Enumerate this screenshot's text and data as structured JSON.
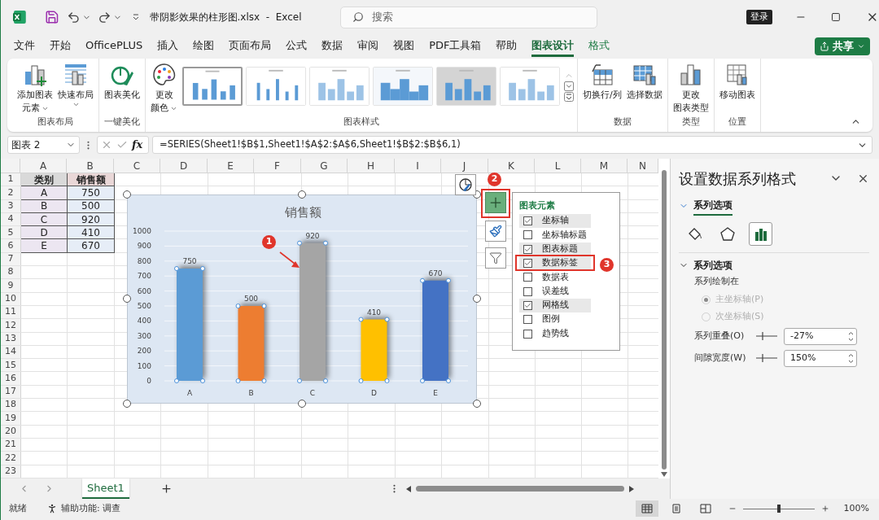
{
  "window": {
    "title": "带阴影效果的柱形图.xlsx  -  Excel"
  },
  "search": {
    "placeholder": "搜索"
  },
  "sign_in": "登录",
  "menu_tabs": [
    {
      "label": "文件",
      "selected": false,
      "kind": "normal"
    },
    {
      "label": "开始",
      "selected": false,
      "kind": "normal"
    },
    {
      "label": "OfficePLUS",
      "selected": false,
      "kind": "normal"
    },
    {
      "label": "插入",
      "selected": false,
      "kind": "normal"
    },
    {
      "label": "绘图",
      "selected": false,
      "kind": "normal"
    },
    {
      "label": "页面布局",
      "selected": false,
      "kind": "normal"
    },
    {
      "label": "公式",
      "selected": false,
      "kind": "normal"
    },
    {
      "label": "数据",
      "selected": false,
      "kind": "normal"
    },
    {
      "label": "审阅",
      "selected": false,
      "kind": "normal"
    },
    {
      "label": "视图",
      "selected": false,
      "kind": "normal"
    },
    {
      "label": "PDF工具箱",
      "selected": false,
      "kind": "normal"
    },
    {
      "label": "帮助",
      "selected": false,
      "kind": "normal"
    },
    {
      "label": "图表设计",
      "selected": true,
      "kind": "context"
    },
    {
      "label": "格式",
      "selected": false,
      "kind": "context"
    }
  ],
  "share": "共享",
  "ribbon": {
    "groups": [
      {
        "label": "图表布局",
        "buttons": [
          {
            "lines": [
              "添加图表",
              "元素"
            ],
            "dropdown": true
          },
          {
            "lines": [
              "快速布局"
            ],
            "dropdown": true
          }
        ]
      },
      {
        "label": "一键美化",
        "buttons": [
          {
            "lines": [
              "图表美化"
            ],
            "dropdown": false
          }
        ]
      },
      {
        "label": "图表样式",
        "buttons": [
          {
            "lines": [
              "更改",
              "颜色"
            ],
            "dropdown": true
          }
        ],
        "gallery": [
          {
            "kind": "plain",
            "selected": true
          },
          {
            "kind": "thin",
            "selected": false
          },
          {
            "kind": "striped",
            "selected": false
          },
          {
            "kind": "bold",
            "selected": false
          },
          {
            "kind": "shaded",
            "selected": false
          },
          {
            "kind": "light",
            "selected": false
          }
        ]
      },
      {
        "label": "数据",
        "buttons": [
          {
            "lines": [
              "切换行/列"
            ],
            "dropdown": false
          },
          {
            "lines": [
              "选择数据"
            ],
            "dropdown": false
          }
        ]
      },
      {
        "label": "类型",
        "buttons": [
          {
            "lines": [
              "更改",
              "图表类型"
            ],
            "dropdown": false
          }
        ]
      },
      {
        "label": "位置",
        "buttons": [
          {
            "lines": [
              "移动图表"
            ],
            "dropdown": false
          }
        ]
      }
    ]
  },
  "formula_bar": {
    "name_box": "图表 2",
    "function_label": "fx",
    "formula": "=SERIES(Sheet1!$B$1,Sheet1!$A$2:$A$6,Sheet1!$B$2:$B$6,1)"
  },
  "grid": {
    "columns": [
      "A",
      "B",
      "C",
      "D",
      "E",
      "F",
      "G",
      "H",
      "I",
      "J",
      "K",
      "L",
      "M",
      "N"
    ],
    "rows": [
      "1",
      "2",
      "3",
      "4",
      "5",
      "6",
      "7",
      "8",
      "9",
      "10",
      "11",
      "12",
      "13",
      "14",
      "15",
      "16",
      "17",
      "18",
      "19",
      "20",
      "21",
      "22",
      "23"
    ],
    "cells": [
      [
        "类别",
        "销售额"
      ],
      [
        "A",
        "750"
      ],
      [
        "B",
        "500"
      ],
      [
        "C",
        "920"
      ],
      [
        "D",
        "410"
      ],
      [
        "E",
        "670"
      ]
    ]
  },
  "chart": {
    "chart_data": {
      "type": "bar",
      "title": "销售额",
      "categories": [
        "A",
        "B",
        "C",
        "D",
        "E"
      ],
      "values": [
        750,
        500,
        920,
        410,
        670
      ],
      "colors": [
        "#5b9bd5",
        "#ed7d31",
        "#a5a5a5",
        "#ffc000",
        "#4472c4"
      ],
      "ylim": [
        0,
        1000
      ],
      "yticks": [
        0,
        100,
        200,
        300,
        400,
        500,
        600,
        700,
        800,
        900,
        1000
      ],
      "grid": true,
      "data_labels": true
    }
  },
  "chart_elements": {
    "title": "图表元素",
    "items": [
      {
        "label": "坐标轴",
        "checked": true
      },
      {
        "label": "坐标轴标题",
        "checked": false
      },
      {
        "label": "图表标题",
        "checked": true
      },
      {
        "label": "数据标签",
        "checked": true
      },
      {
        "label": "数据表",
        "checked": false
      },
      {
        "label": "误差线",
        "checked": false
      },
      {
        "label": "网格线",
        "checked": true
      },
      {
        "label": "图例",
        "checked": false
      },
      {
        "label": "趋势线",
        "checked": false
      }
    ]
  },
  "annotations": [
    "1",
    "2",
    "3"
  ],
  "format_pane": {
    "title": "设置数据系列格式",
    "tab": "系列选项",
    "icons": [
      {
        "kind": "fill",
        "selected": false
      },
      {
        "kind": "effects",
        "selected": false
      },
      {
        "kind": "series",
        "selected": true
      }
    ],
    "section": {
      "title": "系列选项",
      "expanded": true,
      "subtitle": "系列绘制在",
      "radios": [
        {
          "label": "主坐标轴(P)",
          "selected": true,
          "disabled": true
        },
        {
          "label": "次坐标轴(S)",
          "selected": false,
          "disabled": true
        }
      ],
      "fields": [
        {
          "label": "系列重叠(O)",
          "value": "-27%"
        },
        {
          "label": "间隙宽度(W)",
          "value": "150%"
        }
      ]
    }
  },
  "sheet_tabs": [
    {
      "label": "Sheet1",
      "selected": true
    }
  ],
  "status_bar": {
    "ready": "就绪",
    "accessibility": "辅助功能: 调查",
    "views": [
      {
        "kind": "normal",
        "selected": true
      },
      {
        "kind": "page-layout",
        "selected": false
      },
      {
        "kind": "page-break",
        "selected": false
      }
    ],
    "zoom": {
      "level": 0.5,
      "reading": "100%"
    }
  }
}
